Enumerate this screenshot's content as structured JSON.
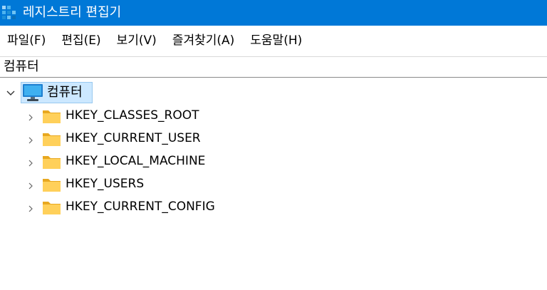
{
  "window": {
    "title": "레지스트리 편집기",
    "icon": "registry-editor-icon",
    "accent_color": "#0078d7"
  },
  "menu": {
    "items": [
      "파일(F)",
      "편집(E)",
      "보기(V)",
      "즐겨찾기(A)",
      "도움말(H)"
    ]
  },
  "address_bar": {
    "value": "컴퓨터"
  },
  "tree": {
    "root": {
      "label": "컴퓨터",
      "icon": "computer-icon",
      "expanded": true,
      "selected": true
    },
    "hives": [
      {
        "label": "HKEY_CLASSES_ROOT",
        "icon": "folder-icon"
      },
      {
        "label": "HKEY_CURRENT_USER",
        "icon": "folder-icon"
      },
      {
        "label": "HKEY_LOCAL_MACHINE",
        "icon": "folder-icon"
      },
      {
        "label": "HKEY_USERS",
        "icon": "folder-icon"
      },
      {
        "label": "HKEY_CURRENT_CONFIG",
        "icon": "folder-icon"
      }
    ]
  }
}
